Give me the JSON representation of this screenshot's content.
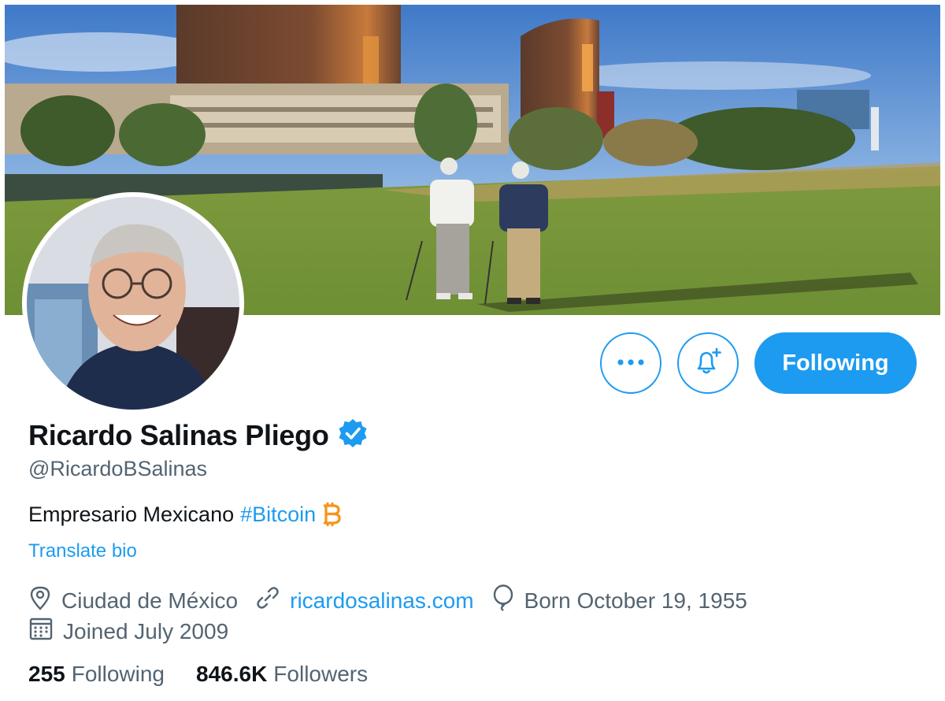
{
  "profile": {
    "display_name": "Ricardo Salinas Pliego",
    "handle": "@RicardoBSalinas",
    "bio_text": "Empresario Mexicano",
    "bio_hashtag": "#Bitcoin",
    "translate_label": "Translate bio",
    "location": "Ciudad de México",
    "website": "ricardosalinas.com",
    "birthday": "Born October 19, 1955",
    "joined": "Joined July 2009",
    "following_count": "255",
    "following_label": "Following",
    "followers_count": "846.6K",
    "followers_label": "Followers"
  },
  "actions": {
    "follow_state_label": "Following"
  },
  "icons": {
    "more": "more-icon",
    "notifications": "bell-plus-icon",
    "verified": "verified-badge-icon",
    "bitcoin": "bitcoin-icon",
    "location": "location-pin-icon",
    "link": "link-icon",
    "birthday": "balloon-icon",
    "joined": "calendar-icon"
  },
  "colors": {
    "accent": "#1d9bf0",
    "text_primary": "#0f1419",
    "text_secondary": "#536471",
    "bitcoin": "#f7931a"
  }
}
